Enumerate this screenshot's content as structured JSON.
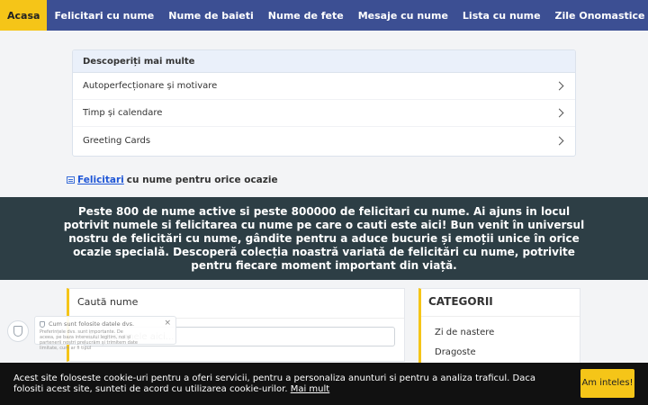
{
  "nav": {
    "items": [
      {
        "label": "Acasa",
        "active": true
      },
      {
        "label": "Felicitari cu nume"
      },
      {
        "label": "Nume de baieti"
      },
      {
        "label": "Nume de fete"
      },
      {
        "label": "Mesaje cu nume"
      },
      {
        "label": "Lista cu nume"
      },
      {
        "label": "Zile Onomastice"
      }
    ]
  },
  "discover": {
    "heading": "Descoperiți mai multe",
    "items": [
      {
        "label": "Autoperfecționare și motivare"
      },
      {
        "label": "Timp și calendare"
      },
      {
        "label": "Greeting Cards"
      }
    ]
  },
  "tagline": {
    "link": "Felicitari",
    "rest": "cu nume pentru orice ocazie"
  },
  "banner": {
    "text": "Peste 800 de nume active si peste 800000 de felicitari cu nume. Ai ajuns in locul potrivit numele si felicitarea cu nume pe care o cauti este aici! Bun venit în universul nostru de felicitări cu nume, gândite pentru a aduce bucurie și emoții unice în orice ocazie specială. Descoperă colecția noastră variată de felicitări cu nume, potrivite pentru fiecare moment important din viață."
  },
  "search": {
    "title": "Caută nume",
    "placeholder": "Scrie numele aici..."
  },
  "categories": {
    "title": "CATEGORII",
    "items": [
      {
        "label": "Zi de nastere"
      },
      {
        "label": "Dragoste"
      }
    ]
  },
  "privacy": {
    "title": "Cum sunt folosite datele dvs.",
    "body": "Preferințele dvs. sunt importante. De aceea, pe baza interesului legitim, noi și partenerii noștri prelucrăm și trimitem date limitate, cum ar fi tipul",
    "close": "×"
  },
  "cookie": {
    "text": "Acest site foloseste cookie-uri pentru a oferi servicii, pentru a personaliza anunturi si pentru a analiza traficul. Daca folositi acest site, sunteti de acord cu utilizarea cookie-urilor.",
    "more": "Mai mult",
    "button": "Am inteles!"
  }
}
